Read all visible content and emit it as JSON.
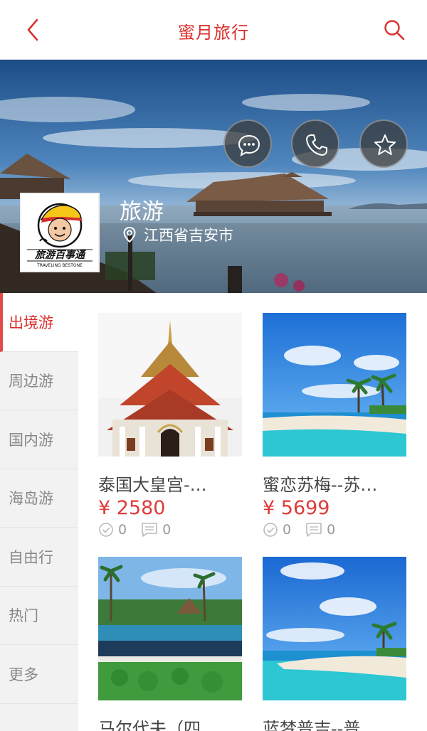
{
  "header": {
    "title": "蜜月旅行"
  },
  "shop": {
    "name": "旅游",
    "location": "江西省吉安市",
    "logo_text": "旅游百事通",
    "logo_subtext": "TRAVELING BESTONE"
  },
  "actions": {
    "message_icon": "chat-bubble-icon",
    "phone_icon": "phone-icon",
    "favorite_icon": "star-icon"
  },
  "sidebar": {
    "items": [
      {
        "label": "出境游"
      },
      {
        "label": "周边游"
      },
      {
        "label": "国内游"
      },
      {
        "label": "海岛游"
      },
      {
        "label": "自由行"
      },
      {
        "label": "热门"
      },
      {
        "label": "更多"
      }
    ]
  },
  "products": [
    {
      "name": "泰国大皇宫-…",
      "price": "¥ 2580",
      "checks": "0",
      "comments": "0"
    },
    {
      "name": "蜜恋苏梅--苏…",
      "price": "¥ 5699",
      "checks": "0",
      "comments": "0"
    },
    {
      "name": "马尔代夫（四…"
    },
    {
      "name": "蓝梦普吉--普…"
    }
  ],
  "colors": {
    "accent": "#d9302d",
    "price": "#e03a3a"
  }
}
